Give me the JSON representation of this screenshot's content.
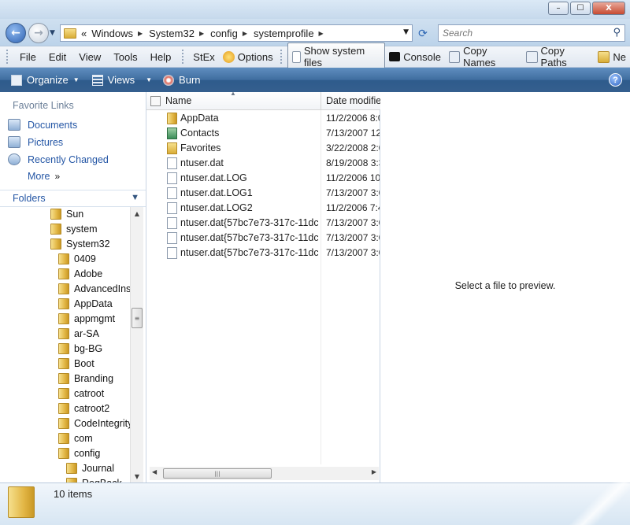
{
  "window": {
    "min": "–",
    "max": "☐",
    "close": "X"
  },
  "address": {
    "prefix": "«",
    "crumbs": [
      "Windows",
      "System32",
      "config",
      "systemprofile"
    ],
    "search_placeholder": "Search"
  },
  "menu": {
    "items": [
      "File",
      "Edit",
      "View",
      "Tools",
      "Help"
    ],
    "stex": "StEx",
    "options": "Options",
    "show_system_files": "Show system files",
    "console": "Console",
    "copy_names": "Copy Names",
    "copy_paths": "Copy Paths",
    "new": "Ne"
  },
  "commands": {
    "organize": "Organize",
    "views": "Views",
    "burn": "Burn"
  },
  "nav": {
    "favorite_header": "Favorite Links",
    "links": [
      "Documents",
      "Pictures",
      "Recently Changed"
    ],
    "more": "More",
    "folders_header": "Folders",
    "tree": [
      {
        "label": "Sun",
        "level": 0
      },
      {
        "label": "system",
        "level": 0
      },
      {
        "label": "System32",
        "level": 0
      },
      {
        "label": "0409",
        "level": 1
      },
      {
        "label": "Adobe",
        "level": 1
      },
      {
        "label": "AdvancedInst",
        "level": 1
      },
      {
        "label": "AppData",
        "level": 1
      },
      {
        "label": "appmgmt",
        "level": 1
      },
      {
        "label": "ar-SA",
        "level": 1
      },
      {
        "label": "bg-BG",
        "level": 1
      },
      {
        "label": "Boot",
        "level": 1
      },
      {
        "label": "Branding",
        "level": 1
      },
      {
        "label": "catroot",
        "level": 1
      },
      {
        "label": "catroot2",
        "level": 1
      },
      {
        "label": "CodeIntegrity",
        "level": 1
      },
      {
        "label": "com",
        "level": 1
      },
      {
        "label": "config",
        "level": 1
      },
      {
        "label": "Journal",
        "level": 2
      },
      {
        "label": "RegBack",
        "level": 2
      }
    ]
  },
  "filelist": {
    "col_name": "Name",
    "col_date": "Date modified",
    "rows": [
      {
        "name": "AppData",
        "date": "11/2/2006 8:0",
        "type": "folder"
      },
      {
        "name": "Contacts",
        "date": "7/13/2007 12:",
        "type": "contacts"
      },
      {
        "name": "Favorites",
        "date": "3/22/2008 2:0",
        "type": "favorites"
      },
      {
        "name": "ntuser.dat",
        "date": "8/19/2008 3:3",
        "type": "doc"
      },
      {
        "name": "ntuser.dat.LOG",
        "date": "11/2/2006 10:",
        "type": "doc"
      },
      {
        "name": "ntuser.dat.LOG1",
        "date": "7/13/2007 3:0",
        "type": "doc"
      },
      {
        "name": "ntuser.dat.LOG2",
        "date": "11/2/2006 7:4",
        "type": "doc"
      },
      {
        "name": "ntuser.dat{57bc7e73-317c-11dc-",
        "date": "7/13/2007 3:0",
        "type": "doc"
      },
      {
        "name": "ntuser.dat{57bc7e73-317c-11dc-",
        "date": "7/13/2007 3:0",
        "type": "doc"
      },
      {
        "name": "ntuser.dat{57bc7e73-317c-11dc-",
        "date": "7/13/2007 3:0",
        "type": "doc"
      }
    ]
  },
  "preview": {
    "message": "Select a file to preview."
  },
  "details": {
    "count": "10 items"
  }
}
